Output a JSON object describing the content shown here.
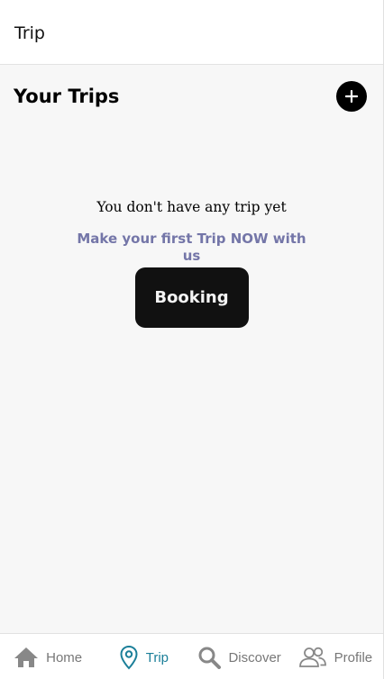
{
  "header": {
    "title": "Trip"
  },
  "section": {
    "title": "Your Trips",
    "add_icon": "plus-icon"
  },
  "empty_state": {
    "message": "You don't have any trip yet",
    "cta": "Make your first Trip NOW with us",
    "button_label": "Booking"
  },
  "bottom_nav": {
    "items": [
      {
        "label": "Home",
        "icon": "home-icon",
        "active": false
      },
      {
        "label": "Trip",
        "icon": "map-pin-icon",
        "active": true
      },
      {
        "label": "Discover",
        "icon": "search-icon",
        "active": false
      },
      {
        "label": "Profile",
        "icon": "users-icon",
        "active": false
      }
    ]
  },
  "colors": {
    "active_nav": "#1b7f99",
    "inactive_nav": "#777777",
    "cta_text": "#7476a8",
    "button_bg": "#111111",
    "page_bg": "#f7f7f7"
  }
}
